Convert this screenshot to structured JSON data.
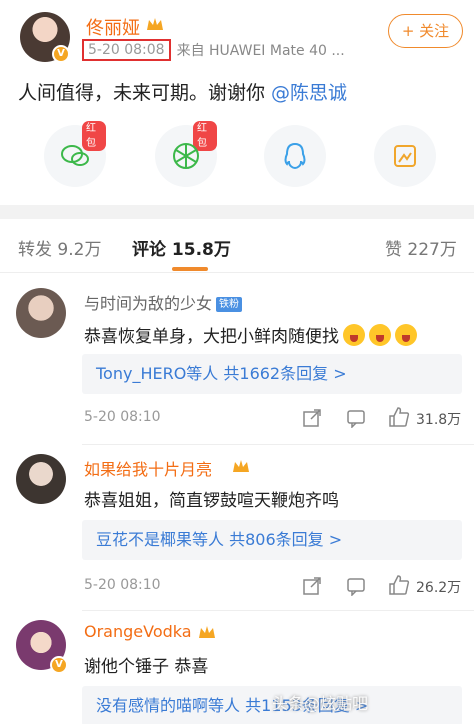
{
  "post": {
    "author": "佟丽娅",
    "follow_label": "+ 关注",
    "time": "5-20 08:08",
    "source": "来自 HUAWEI Mate 40 ...",
    "text": "人间值得，未来可期。谢谢你 ",
    "mention": "@陈思诚"
  },
  "share": {
    "redpack_label": "红包",
    "items": [
      "wechat-icon",
      "moments-icon",
      "qq-icon",
      "qzone-icon"
    ]
  },
  "tabs": {
    "repost": "转发 9.2万",
    "comments": "评论 15.8万",
    "likes": "赞 227万"
  },
  "comments": [
    {
      "name": "与时间为敌的少女",
      "badge": "铁粉",
      "text": "恭喜恢复单身，大把小鲜肉随便找",
      "reply": "Tony_HERO等人  共1662条回复 >",
      "time": "5-20 08:10",
      "likes": "31.8万"
    },
    {
      "name": "如果给我十片月亮",
      "text": "恭喜姐姐，简直锣鼓喧天鞭炮齐鸣",
      "reply": "豆花不是椰果等人  共806条回复 >",
      "time": "5-20 08:10",
      "likes": "26.2万"
    },
    {
      "name": "OrangeVodka",
      "text": "谢他个锤子 恭喜",
      "reply": "没有感情的喵啊等人  共1153条回复 >"
    }
  ],
  "watermark": "头条@炫贴吧",
  "colors": {
    "accent": "#f08a2c",
    "link": "#3a7bd5",
    "name_orange": "#f36d14"
  }
}
